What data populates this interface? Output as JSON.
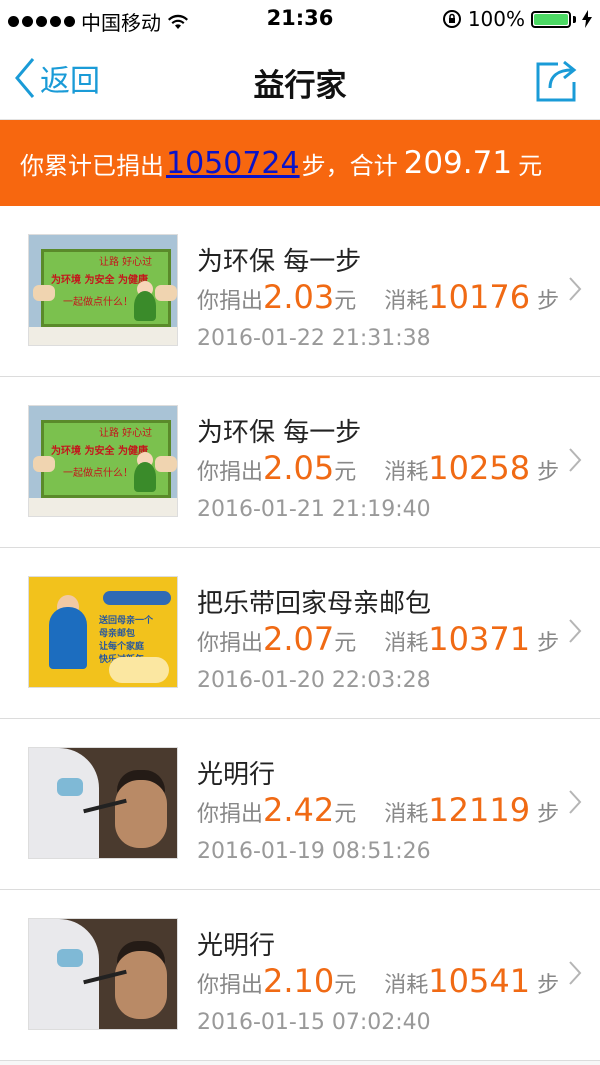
{
  "status_bar": {
    "carrier": "中国移动",
    "time": "21:36",
    "battery": "100%"
  },
  "nav": {
    "back_label": "返回",
    "title": "益行家"
  },
  "summary": {
    "prefix": "你累计已捐出",
    "steps": "1050724",
    "steps_unit": "步，合计",
    "amount": "209.71",
    "amount_unit": "元"
  },
  "labels": {
    "donated": "你捐出",
    "yuan": "元",
    "consumed": "消耗",
    "step": "步"
  },
  "items": [
    {
      "title": "为环保 每一步",
      "amount": "2.03",
      "steps": "10176",
      "date": "2016-01-22 21:31:38",
      "thumb": "eco"
    },
    {
      "title": "为环保 每一步",
      "amount": "2.05",
      "steps": "10258",
      "date": "2016-01-21 21:19:40",
      "thumb": "eco"
    },
    {
      "title": "把乐带回家母亲邮包",
      "amount": "2.07",
      "steps": "10371",
      "date": "2016-01-20 22:03:28",
      "thumb": "mom"
    },
    {
      "title": "光明行",
      "amount": "2.42",
      "steps": "12119",
      "date": "2016-01-19 08:51:26",
      "thumb": "eye"
    },
    {
      "title": "光明行",
      "amount": "2.10",
      "steps": "10541",
      "date": "2016-01-15 07:02:40",
      "thumb": "eye"
    }
  ],
  "thumb_text": {
    "eco_logo": "让路 好心过",
    "eco_line1": "为环境 为安全 为健康",
    "eco_line2": "一起做点什么！",
    "mom_lines": [
      "送回母亲一个",
      "母亲邮包",
      "让每个家庭",
      "快乐过新年"
    ]
  },
  "colors": {
    "accent_orange": "#f7670f",
    "link_blue": "#0a13c8",
    "ios_blue": "#1a9bd7",
    "value_orange": "#f06a14"
  },
  "icons": {
    "back": "chevron-left-icon",
    "share": "share-icon",
    "row": "chevron-right-icon"
  }
}
